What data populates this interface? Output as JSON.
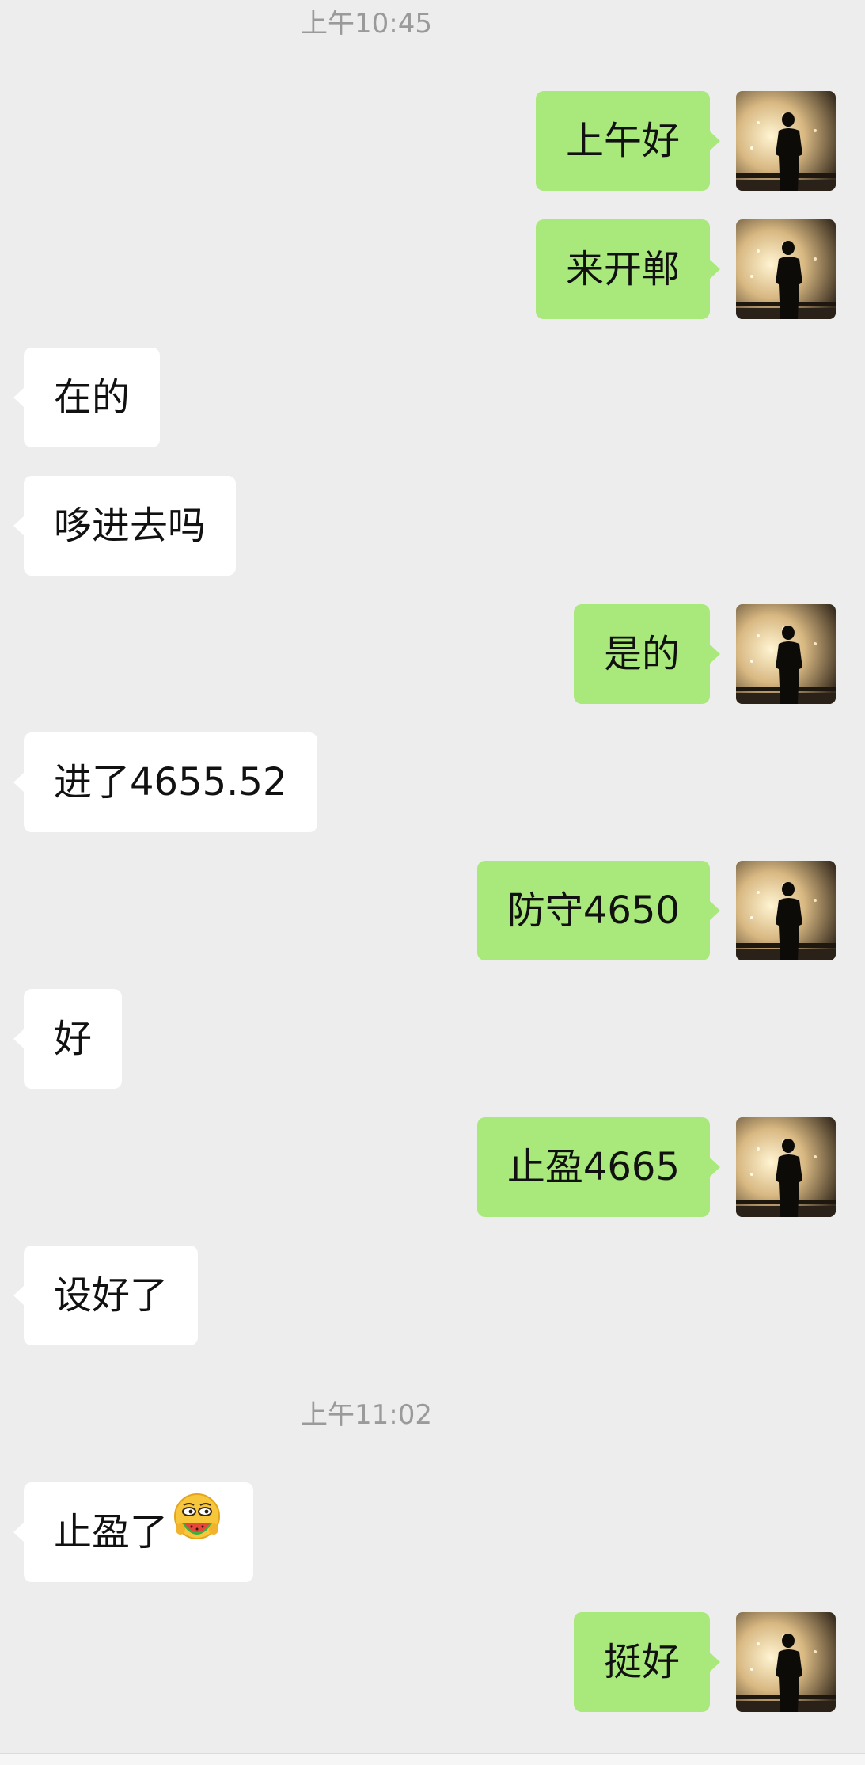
{
  "timestamps": [
    "上午10:45",
    "上午11:02"
  ],
  "messages": [
    {
      "side": "out",
      "text": "上午好"
    },
    {
      "side": "out",
      "text": "来开郸"
    },
    {
      "side": "in",
      "text": "在的"
    },
    {
      "side": "in",
      "text": "哆进去吗"
    },
    {
      "side": "out",
      "text": "是的"
    },
    {
      "side": "in",
      "text": "进了4655.52"
    },
    {
      "side": "out",
      "text": "防守4650"
    },
    {
      "side": "in",
      "text": "好"
    },
    {
      "side": "out",
      "text": "止盈4665"
    },
    {
      "side": "in",
      "text": "设好了"
    },
    {
      "side": "in",
      "text": "止盈了",
      "emoji": "eating-watermelon-emoji"
    },
    {
      "side": "out",
      "text": "挺好"
    }
  ],
  "icons": {
    "avatar": "silhouette-avatar-icon"
  },
  "colors": {
    "background": "#ededed",
    "outgoing_bubble": "#a9e97b",
    "incoming_bubble": "#ffffff",
    "timestamp_text": "#9a9a9a"
  }
}
